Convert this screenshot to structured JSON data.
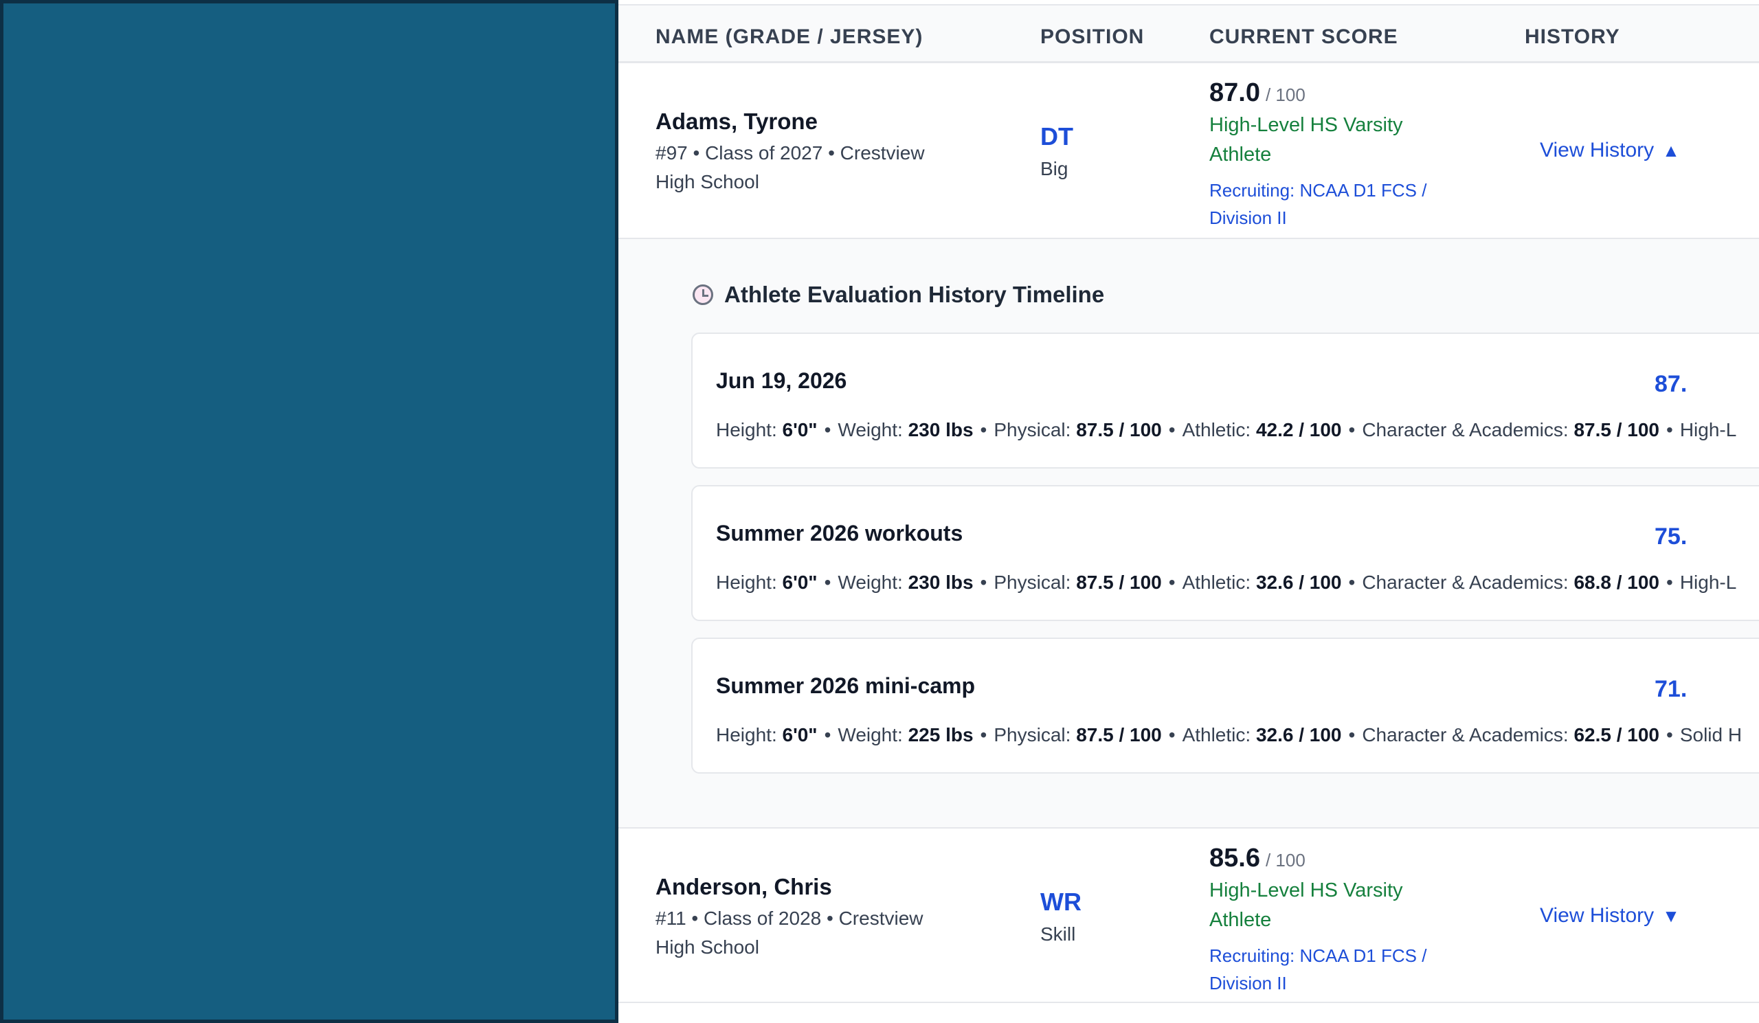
{
  "columns": {
    "name": "NAME (GRADE / JERSEY)",
    "position": "POSITION",
    "score": "CURRENT SCORE",
    "history": "HISTORY"
  },
  "players": [
    {
      "name": "Adams, Tyrone",
      "meta_line1": "#97 • Class of 2027 • Crestview",
      "meta_line2": "High School",
      "position": "DT",
      "position_group": "Big",
      "score": "87.0",
      "score_max": "/ 100",
      "level_line1": "High-Level HS Varsity",
      "level_line2": "Athlete",
      "recruit_line1": "Recruiting: NCAA D1 FCS /",
      "recruit_line2": "Division II",
      "history_label": "View History",
      "history_arrow": "▲"
    },
    {
      "name": "Anderson, Chris",
      "meta_line1": "#11 • Class of 2028 • Crestview",
      "meta_line2": "High School",
      "position": "WR",
      "position_group": "Skill",
      "score": "85.6",
      "score_max": "/ 100",
      "level_line1": "High-Level HS Varsity",
      "level_line2": "Athlete",
      "recruit_line1": "Recruiting: NCAA D1 FCS /",
      "recruit_line2": "Division II",
      "history_label": "View History",
      "history_arrow": "▼"
    }
  ],
  "timeline": {
    "title": "Athlete Evaluation History Timeline",
    "labels": {
      "height": "Height:",
      "weight": "Weight:",
      "physical": "Physical:",
      "athletic": "Athletic:",
      "character": "Character & Academics:"
    },
    "entries": [
      {
        "date": "Jun 19, 2026",
        "score": "87.",
        "height": "6'0\"",
        "weight": "230 lbs",
        "physical": "87.5 / 100",
        "athletic": "42.2 / 100",
        "character": "87.5 / 100",
        "level": "High-L"
      },
      {
        "date": "Summer 2026 workouts",
        "score": "75.",
        "height": "6'0\"",
        "weight": "230 lbs",
        "physical": "87.5 / 100",
        "athletic": "32.6 / 100",
        "character": "68.8 / 100",
        "level": "High-L"
      },
      {
        "date": "Summer 2026 mini-camp",
        "score": "71.",
        "height": "6'0\"",
        "weight": "225 lbs",
        "physical": "87.5 / 100",
        "athletic": "32.6 / 100",
        "character": "62.5 / 100",
        "level": "Solid H"
      }
    ]
  }
}
